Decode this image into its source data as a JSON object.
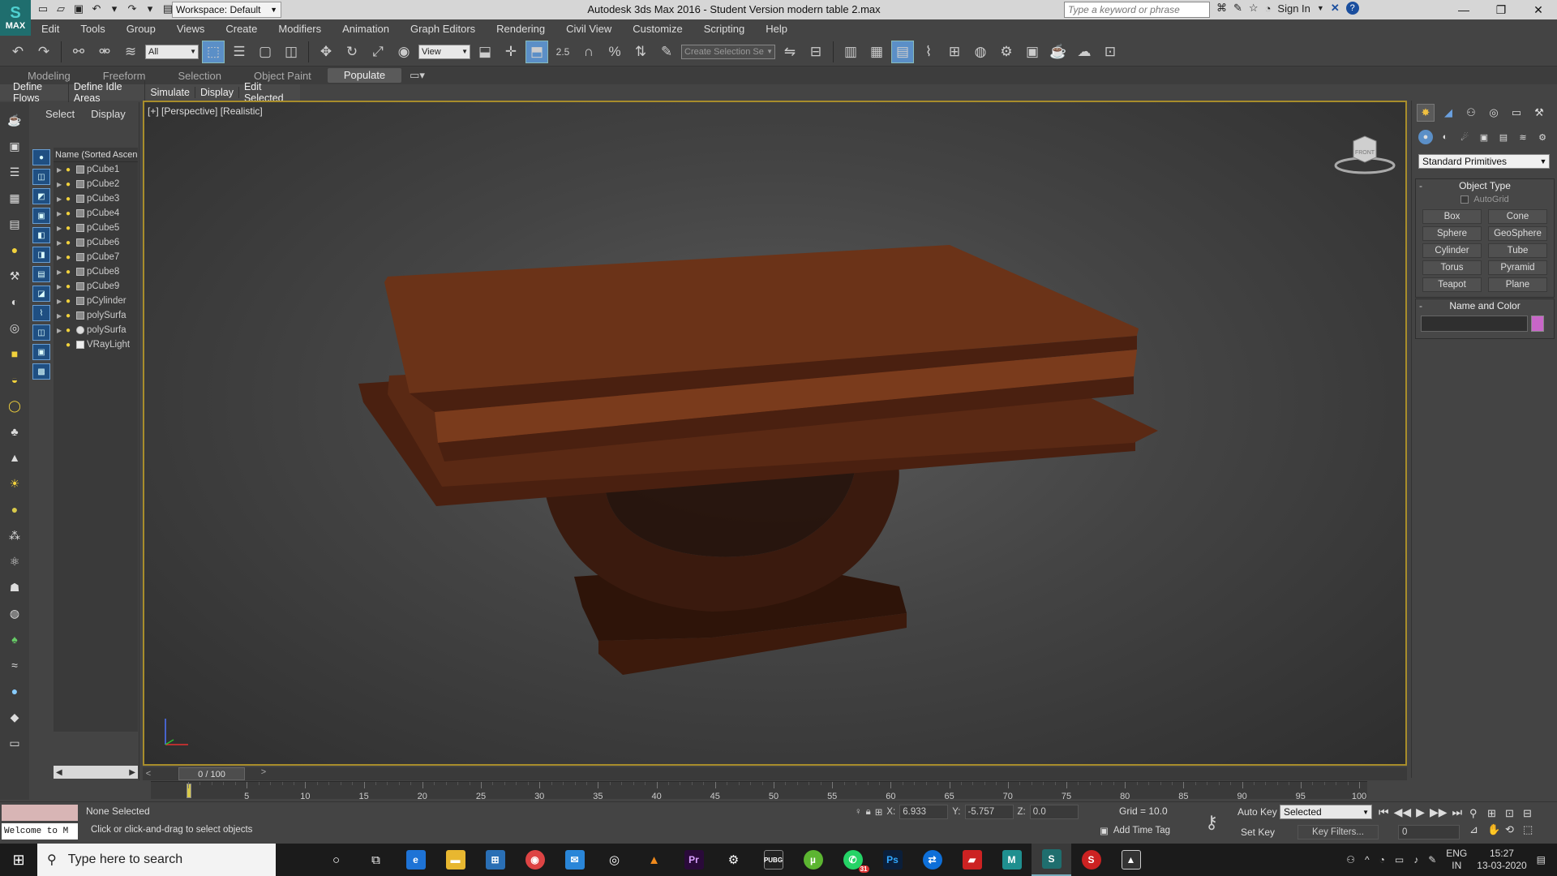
{
  "app": {
    "title": "Autodesk 3ds Max 2016 - Student Version   modern table 2.max",
    "logo_text": "MAX",
    "workspace": "Workspace: Default",
    "search_placeholder": "Type a keyword or phrase",
    "sign_in": "Sign In"
  },
  "menubar": [
    "Edit",
    "Tools",
    "Group",
    "Views",
    "Create",
    "Modifiers",
    "Animation",
    "Graph Editors",
    "Rendering",
    "Civil View",
    "Customize",
    "Scripting",
    "Help"
  ],
  "toolbar": {
    "filter_value": "All",
    "refcoord_value": "View",
    "snap_label": "2.5",
    "named_selection": "Create Selection Se"
  },
  "ribbon": {
    "tabs": [
      "Modeling",
      "Freeform",
      "Selection",
      "Object Paint",
      "Populate"
    ],
    "active_tab": "Populate",
    "populate_tools": [
      "Define Flows",
      "Define Idle Areas",
      "Simulate",
      "Display",
      "Edit Selected"
    ]
  },
  "explorer": {
    "tabs": [
      "Select",
      "Display"
    ],
    "header": "Name (Sorted Ascending)",
    "items": [
      {
        "name": "pCube1",
        "kind": "mesh"
      },
      {
        "name": "pCube2",
        "kind": "mesh"
      },
      {
        "name": "pCube3",
        "kind": "mesh"
      },
      {
        "name": "pCube4",
        "kind": "mesh"
      },
      {
        "name": "pCube5",
        "kind": "mesh"
      },
      {
        "name": "pCube6",
        "kind": "mesh"
      },
      {
        "name": "pCube7",
        "kind": "mesh"
      },
      {
        "name": "pCube8",
        "kind": "mesh"
      },
      {
        "name": "pCube9",
        "kind": "mesh"
      },
      {
        "name": "pCylinder",
        "kind": "mesh"
      },
      {
        "name": "polySurfa",
        "kind": "mesh"
      },
      {
        "name": "polySurfa",
        "kind": "sphere"
      },
      {
        "name": "VRayLight",
        "kind": "light"
      }
    ]
  },
  "viewport": {
    "label": "[+] [Perspective] [Realistic]",
    "viewcube_face": "FRONT",
    "table_colors": {
      "top": "#6b3318",
      "edge": "#4a2010",
      "base": "#3a1a0e",
      "shadow": "#241008"
    }
  },
  "command_panel": {
    "dropdown": "Standard Primitives",
    "object_type_title": "Object Type",
    "autogrid": "AutoGrid",
    "primitives": [
      "Box",
      "Cone",
      "Sphere",
      "GeoSphere",
      "Cylinder",
      "Tube",
      "Torus",
      "Pyramid",
      "Teapot",
      "Plane"
    ],
    "name_color_title": "Name and Color",
    "object_color": "#c866c8"
  },
  "timeline": {
    "slider": "0 / 100",
    "ticks": [
      "0",
      "5",
      "10",
      "15",
      "20",
      "25",
      "30",
      "35",
      "40",
      "45",
      "50",
      "55",
      "60",
      "65",
      "70",
      "75",
      "80",
      "85",
      "90",
      "95",
      "100"
    ]
  },
  "statusbar": {
    "maxscript_output": "Welcome to M",
    "selection": "None Selected",
    "prompt": "Click or click-and-drag to select objects",
    "x": "6.933",
    "y": "-5.757",
    "z": "0.0",
    "x_label": "X:",
    "y_label": "Y:",
    "z_label": "Z:",
    "grid": "Grid = 10.0",
    "add_time_tag": "Add Time Tag",
    "auto_key": "Auto Key",
    "set_key": "Set Key",
    "key_mode": "Selected",
    "key_filters": "Key Filters...",
    "frame": "0"
  },
  "taskbar": {
    "search": "Type here to search",
    "lang1": "ENG",
    "lang2": "IN",
    "time": "15:27",
    "date": "13-03-2020",
    "badge": "31"
  }
}
